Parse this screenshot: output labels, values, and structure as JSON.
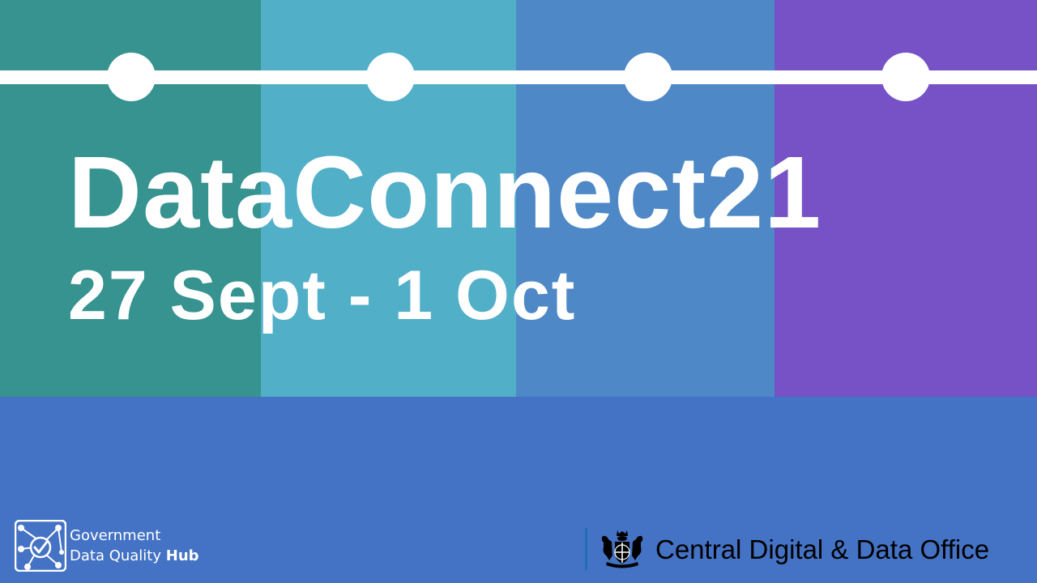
{
  "colors": {
    "background": "#4472c4",
    "bands": [
      "#36938f",
      "#52afc8",
      "#4f88c6",
      "#7752c7"
    ],
    "text": "#ffffff"
  },
  "banner": {
    "title": "DataConnect21",
    "dates": "27 Sept - 1 Oct"
  },
  "logos": {
    "dqh": {
      "line1": "Government",
      "line2_prefix": "Data Quality ",
      "line2_bold": "Hub"
    },
    "cddo": {
      "name": "Central Digital & Data Office",
      "icon": "royal-coat-of-arms-icon"
    }
  }
}
